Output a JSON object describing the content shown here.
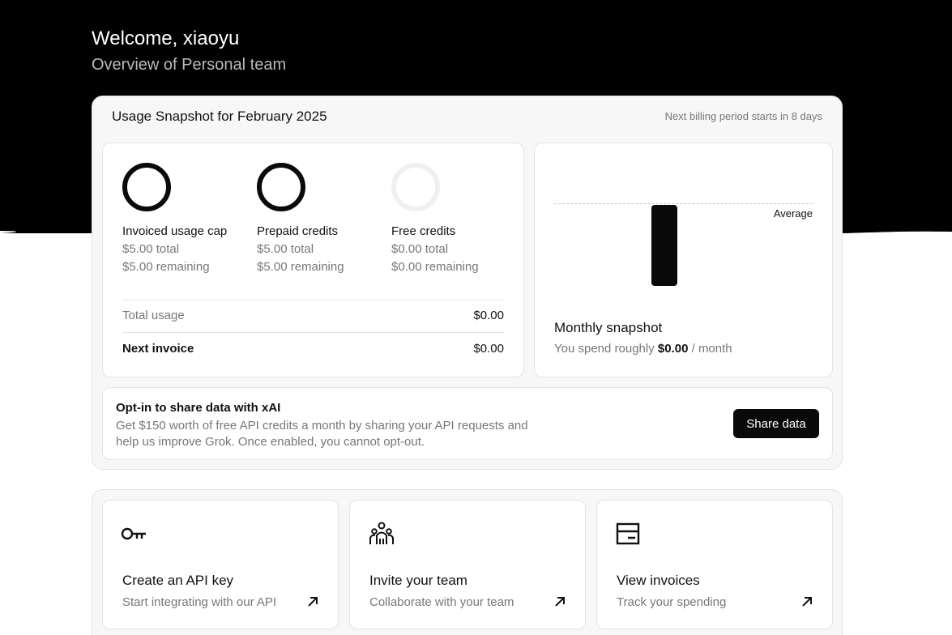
{
  "header": {
    "welcome": "Welcome, xiaoyu",
    "subtitle": "Overview of Personal team"
  },
  "usage": {
    "title": "Usage Snapshot for February 2025",
    "billing_note": "Next billing period starts in 8 days",
    "metrics": [
      {
        "title": "Invoiced usage cap",
        "total": "$5.00 total",
        "remaining": "$5.00 remaining"
      },
      {
        "title": "Prepaid credits",
        "total": "$5.00 total",
        "remaining": "$5.00 remaining"
      },
      {
        "title": "Free credits",
        "total": "$0.00 total",
        "remaining": "$0.00 remaining"
      }
    ],
    "total_usage_label": "Total usage",
    "total_usage_value": "$0.00",
    "next_invoice_label": "Next invoice",
    "next_invoice_value": "$0.00"
  },
  "snapshot": {
    "average_label": "Average",
    "title": "Monthly snapshot",
    "spend_prefix": "You spend roughly ",
    "spend_value": "$0.00",
    "spend_suffix": " / month"
  },
  "optin": {
    "title": "Opt-in to share data with xAI",
    "description": "Get $150 worth of free API credits a month by sharing your API requests and help us improve Grok. Once enabled, you cannot opt-out.",
    "button": "Share data"
  },
  "actions": [
    {
      "icon": "key-icon",
      "title": "Create an API key",
      "subtitle": "Start integrating with our API"
    },
    {
      "icon": "team-icon",
      "title": "Invite your team",
      "subtitle": "Collaborate with your team"
    },
    {
      "icon": "invoice-icon",
      "title": "View invoices",
      "subtitle": "Track your spending"
    }
  ],
  "colors": {
    "accent": "#0a0a0a",
    "background": "#ffffff",
    "panel": "#f7f7f7",
    "muted_text": "#777777"
  }
}
